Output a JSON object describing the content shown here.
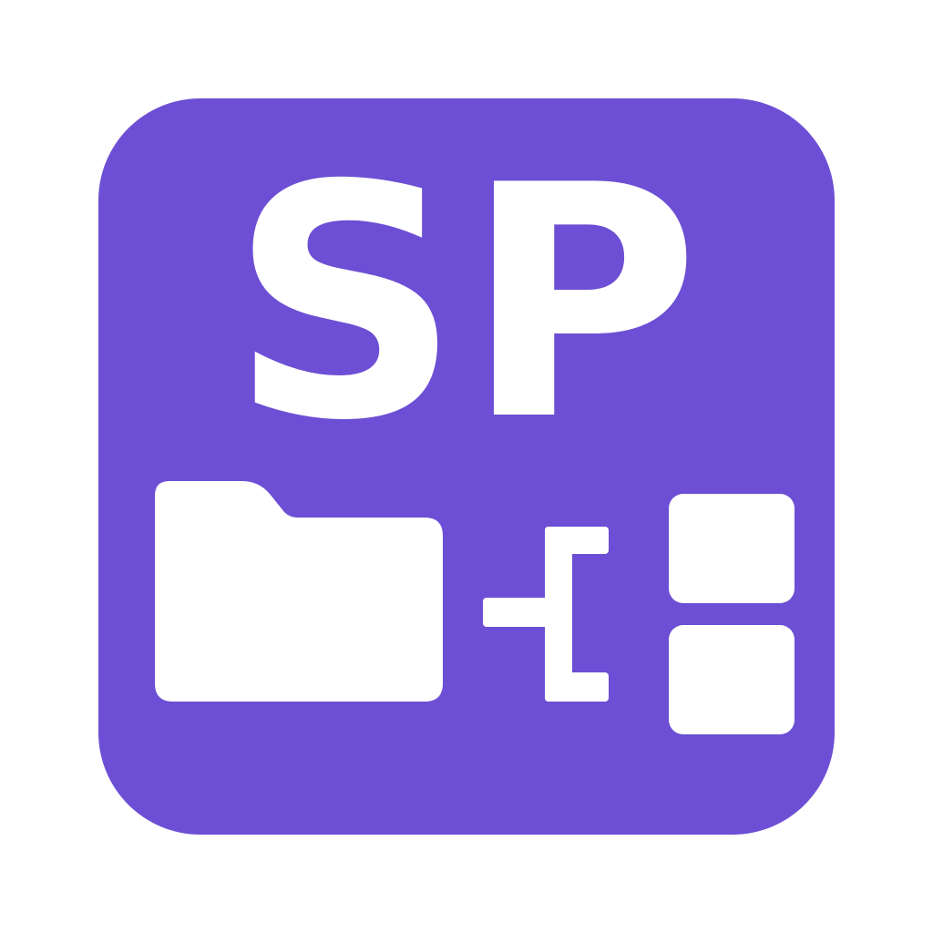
{
  "icon": {
    "monogram": "SP",
    "background_color": "#6c4fd4",
    "foreground_color": "#ffffff",
    "symbols": [
      "folder-icon",
      "tree-connector-icon",
      "tile-icon",
      "tile-icon"
    ]
  }
}
